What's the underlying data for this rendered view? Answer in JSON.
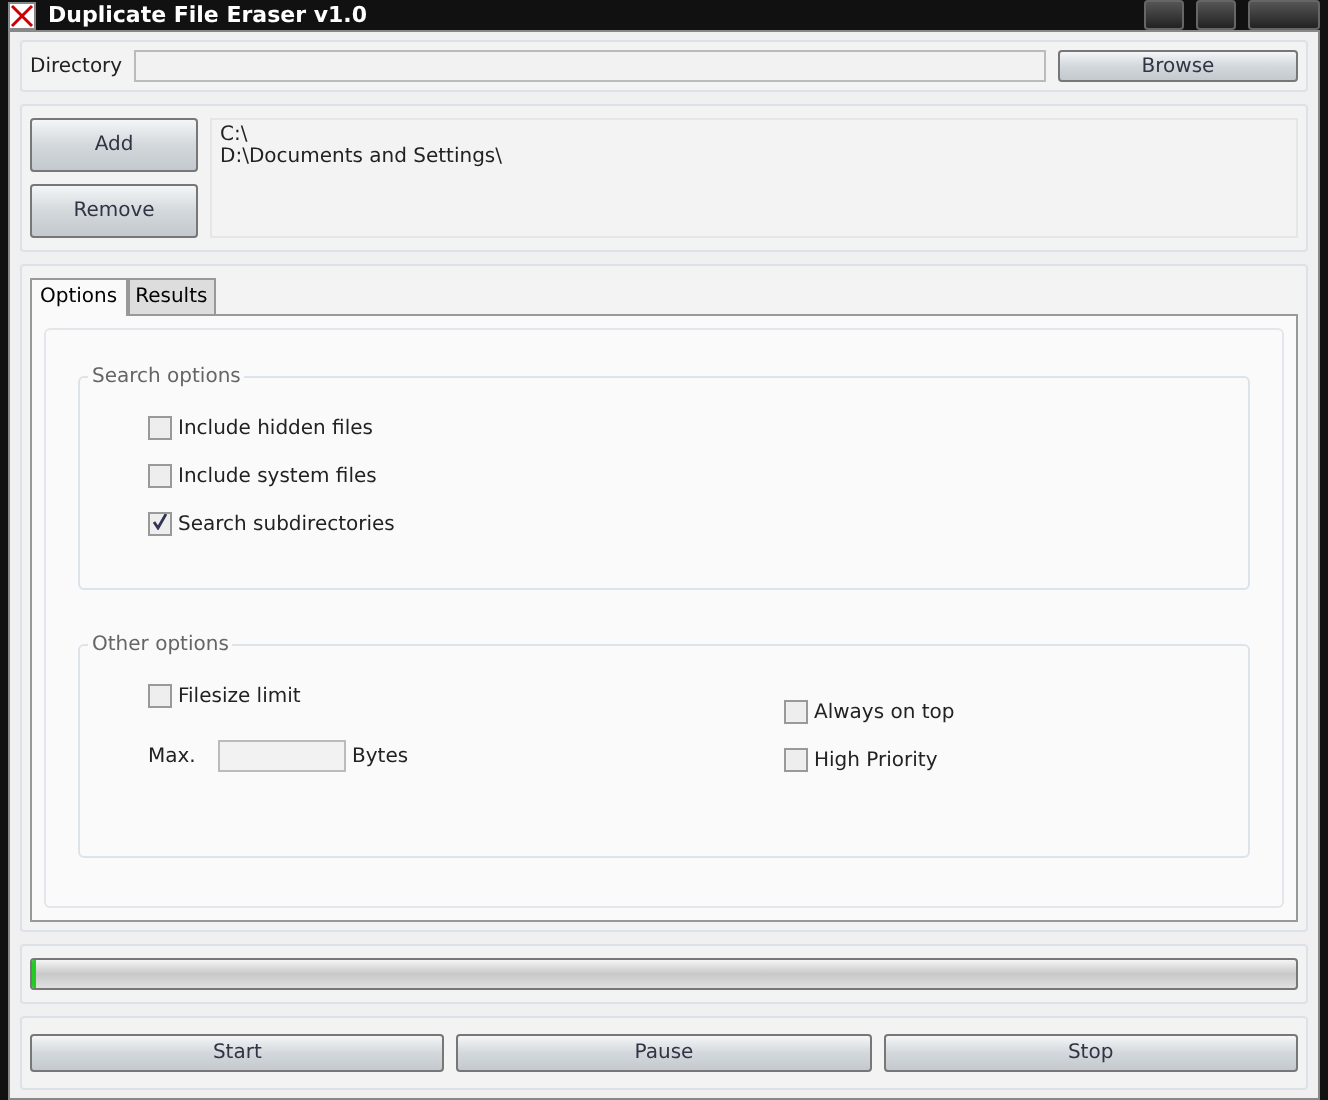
{
  "window": {
    "title": "Duplicate File Eraser v1.0"
  },
  "directory": {
    "label": "Directory",
    "browse": "Browse"
  },
  "folders": {
    "buttons": [
      "Add",
      "Remove"
    ],
    "items": [
      "C:\\",
      "D:\\Documents and Settings\\"
    ]
  },
  "tabs": [
    {
      "label": "Options",
      "selected": true
    },
    {
      "label": "Results",
      "selected": false
    }
  ],
  "search_options": {
    "title": "Search options",
    "checkboxes": [
      {
        "label": "Include hidden files",
        "checked": false
      },
      {
        "label": "Include system files",
        "checked": false
      },
      {
        "label": "Search subdirectories",
        "checked": true
      }
    ]
  },
  "other_options": {
    "title": "Other options",
    "filesize": {
      "label": "Filesize limit",
      "checked": false
    },
    "max_label": "Max.",
    "unit": "Bytes",
    "right": [
      {
        "label": "Always on top",
        "checked": false
      },
      {
        "label": "High Priority",
        "checked": false
      }
    ]
  },
  "progress": {
    "level": 0.003
  },
  "actions": [
    "Start",
    "Pause",
    "Stop"
  ]
}
